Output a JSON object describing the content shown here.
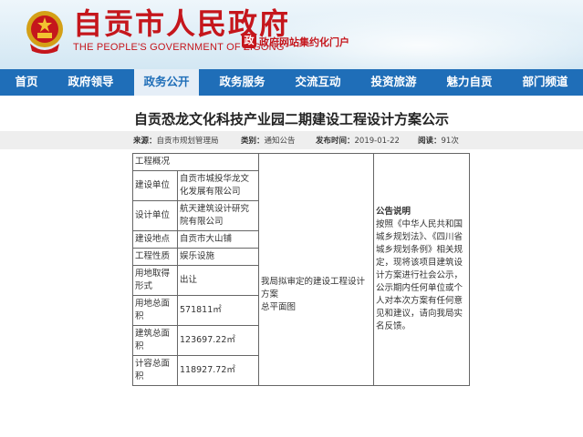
{
  "header": {
    "site_title": "自贡市人民政府",
    "site_subtitle": "THE PEOPLE'S GOVERNMENT OF ZIGONG",
    "portal_badge": "政",
    "portal_text": "政府网站集约化门户"
  },
  "nav": {
    "items": [
      {
        "label": "首页"
      },
      {
        "label": "政府领导"
      },
      {
        "label": "政务公开"
      },
      {
        "label": "政务服务"
      },
      {
        "label": "交流互动"
      },
      {
        "label": "投资旅游"
      },
      {
        "label": "魅力自贡"
      },
      {
        "label": "部门频道"
      }
    ],
    "active_index": 2
  },
  "article": {
    "title": "自贡恐龙文化科技产业园二期建设工程设计方案公示",
    "meta": {
      "source_label": "来源：",
      "source": "自贡市规划管理局",
      "category_label": "类别：",
      "category": "通知公告",
      "time_label": "发布时间：",
      "time": "2019-01-22",
      "views_label": "阅读：",
      "views": "91次"
    }
  },
  "table": {
    "overview_header": "工程概况",
    "rows": [
      {
        "label": "建设单位",
        "value": "自贡市城投华龙文化发展有限公司"
      },
      {
        "label": "设计单位",
        "value": "航天建筑设计研究院有限公司"
      },
      {
        "label": "建设地点",
        "value": "自贡市大山铺"
      },
      {
        "label": "工程性质",
        "value": "娱乐设施"
      },
      {
        "label": "用地取得形式",
        "value": "出让"
      },
      {
        "label": "用地总面积",
        "value": "571811㎡"
      },
      {
        "label": "建筑总面积",
        "value": "123697.22㎡"
      },
      {
        "label": "计容总面积",
        "value": "118927.72㎡"
      }
    ],
    "middle_line1": "我局拟审定的建设工程设计方案",
    "middle_line2": "总平面图",
    "notice_title": "公告说明",
    "notice_body": "按照《中华人民共和国城乡规划法》、《四川省城乡规划条例》相关规定，现将该项目建筑设计方案进行社会公示，公示期内任何单位或个人对本次方案有任何意见和建议，请向我局实名反馈。"
  },
  "colors": {
    "brand_red": "#c5161c",
    "nav_blue": "#1f6eb8",
    "active_tab_bg": "#e5eef7"
  }
}
